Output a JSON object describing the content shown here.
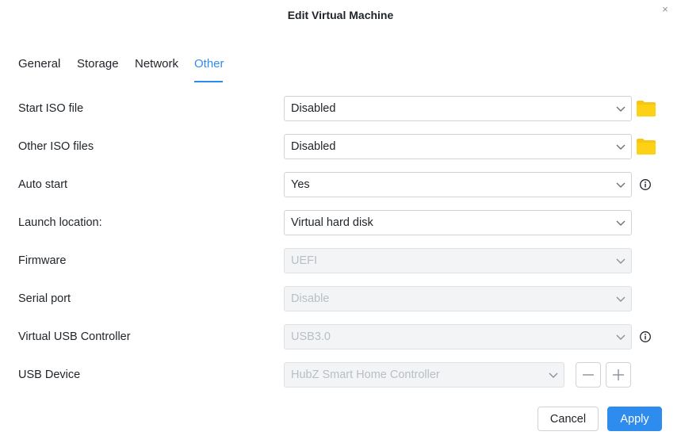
{
  "dialog": {
    "title": "Edit Virtual Machine",
    "close_glyph": "×"
  },
  "tabs": [
    {
      "label": "General",
      "active": false
    },
    {
      "label": "Storage",
      "active": false
    },
    {
      "label": "Network",
      "active": false
    },
    {
      "label": "Other",
      "active": true
    }
  ],
  "form": {
    "start_iso": {
      "label": "Start ISO file",
      "value": "Disabled",
      "icon": "folder-icon"
    },
    "other_iso": {
      "label": "Other ISO files",
      "value": "Disabled",
      "icon": "folder-icon"
    },
    "auto_start": {
      "label": "Auto start",
      "value": "Yes",
      "icon": "info-icon"
    },
    "launch_location": {
      "label": "Launch location:",
      "value": "Virtual hard disk"
    },
    "firmware": {
      "label": "Firmware",
      "value": "UEFI",
      "disabled": true
    },
    "serial_port": {
      "label": "Serial port",
      "value": "Disable",
      "disabled": true
    },
    "usb_controller": {
      "label": "Virtual USB Controller",
      "value": "USB3.0",
      "disabled": true,
      "icon": "info-icon"
    },
    "usb_device": {
      "label": "USB Device",
      "value": "HubZ Smart Home Controller",
      "disabled": true
    }
  },
  "buttons": {
    "cancel": "Cancel",
    "apply": "Apply"
  },
  "colors": {
    "accent": "#2f8cef",
    "folder": "#f9c511",
    "disabled_bg": "#f3f4f6",
    "disabled_text": "#b9bec6"
  }
}
